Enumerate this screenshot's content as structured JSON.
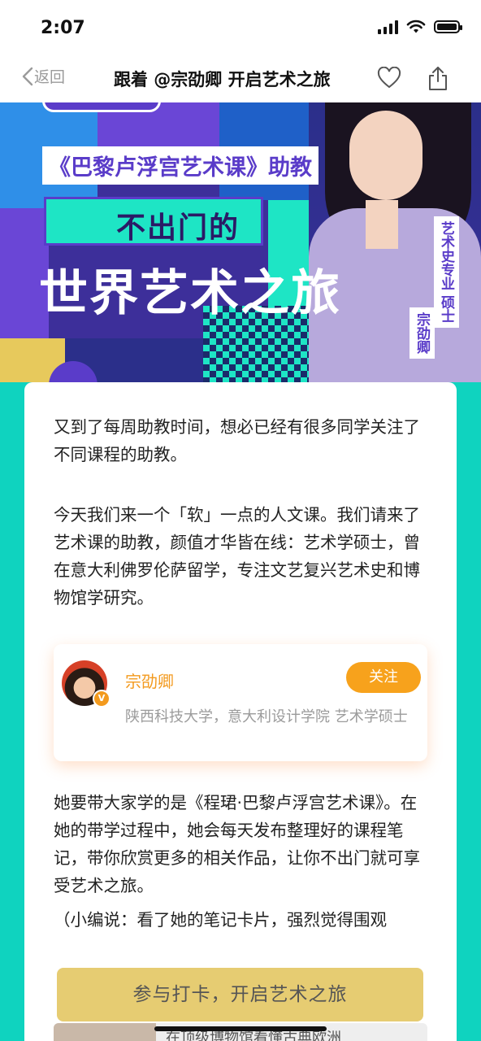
{
  "status": {
    "time": "2:07"
  },
  "nav": {
    "back_label": "返回",
    "title": "跟着 @宗劭卿 开启艺术之旅"
  },
  "hero": {
    "subtitle": "《巴黎卢浮宫艺术课》助教",
    "headline_1": "不出门的",
    "headline_2": "世界艺术之旅",
    "tag_1": "艺术史专业 硕士",
    "tag_2": "宗劭卿"
  },
  "article": {
    "p1": "又到了每周助教时间，想必已经有很多同学关注了不同课程的助教。",
    "p2": "今天我们来一个「软」一点的人文课。我们请来了艺术课的助教，颜值才华皆在线：艺术学硕士，曾在意大利佛罗伦萨留学，专注文艺复兴艺术史和博物馆学研究。",
    "p3": "她要带大家学的是《程珺·巴黎卢浮宫艺术课》。在她的带学过程中，她会每天发布整理好的课程笔记，带你欣赏更多的相关作品，让你不出门就可享受艺术之旅。",
    "p4": "（小编说：看了她的笔记卡片，强烈觉得围观"
  },
  "author_card": {
    "name": "宗劭卿",
    "follow_label": "关注",
    "description": "陕西科技大学，意大利设计学院 艺术学硕士"
  },
  "cta": {
    "label": "参与打卡，开启艺术之旅"
  },
  "peek": {
    "text": "在顶级博物馆看懂古典欧洲"
  }
}
